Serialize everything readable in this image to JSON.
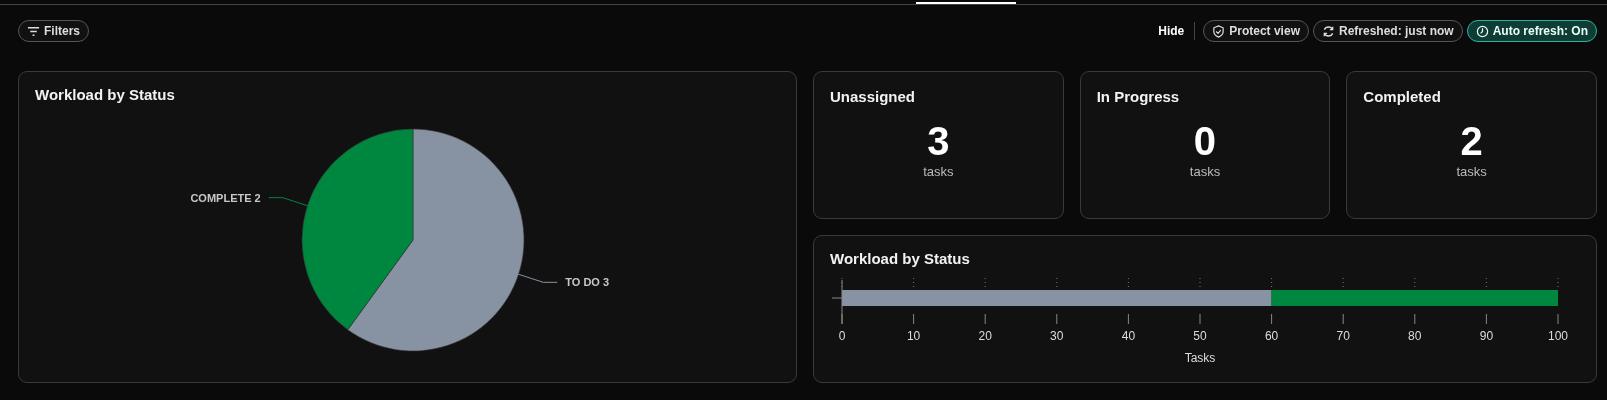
{
  "toolbar": {
    "filters": {
      "label": "Filters"
    },
    "hide": {
      "label": "Hide"
    },
    "protect": {
      "label": "Protect view"
    },
    "refreshed": {
      "label": "Refreshed: just now"
    },
    "auto_refresh": {
      "label": "Auto refresh: On",
      "on": true
    }
  },
  "pie_card": {
    "title": "Workload by Status",
    "chart_data": {
      "type": "pie",
      "values": [
        3,
        2
      ],
      "colors": [
        "#8792a2",
        "#00873f"
      ],
      "value_labels": [
        "TO DO 3",
        "COMPLETE 2"
      ]
    }
  },
  "stats": [
    {
      "title": "Unassigned",
      "value": "3",
      "unit": "tasks"
    },
    {
      "title": "In Progress",
      "value": "0",
      "unit": "tasks"
    },
    {
      "title": "Completed",
      "value": "2",
      "unit": "tasks"
    }
  ],
  "bar_card": {
    "title": "Workload by Status",
    "chart_data": {
      "type": "bar",
      "orientation": "horizontal",
      "stacked": true,
      "xlabel": "Tasks",
      "xlim": [
        0,
        100
      ],
      "xticks": [
        0,
        10,
        20,
        30,
        40,
        50,
        60,
        70,
        80,
        90,
        100
      ],
      "series": [
        {
          "color": "#8792a2",
          "values": [
            60
          ]
        },
        {
          "color": "#00873f",
          "values": [
            40
          ]
        }
      ]
    }
  }
}
